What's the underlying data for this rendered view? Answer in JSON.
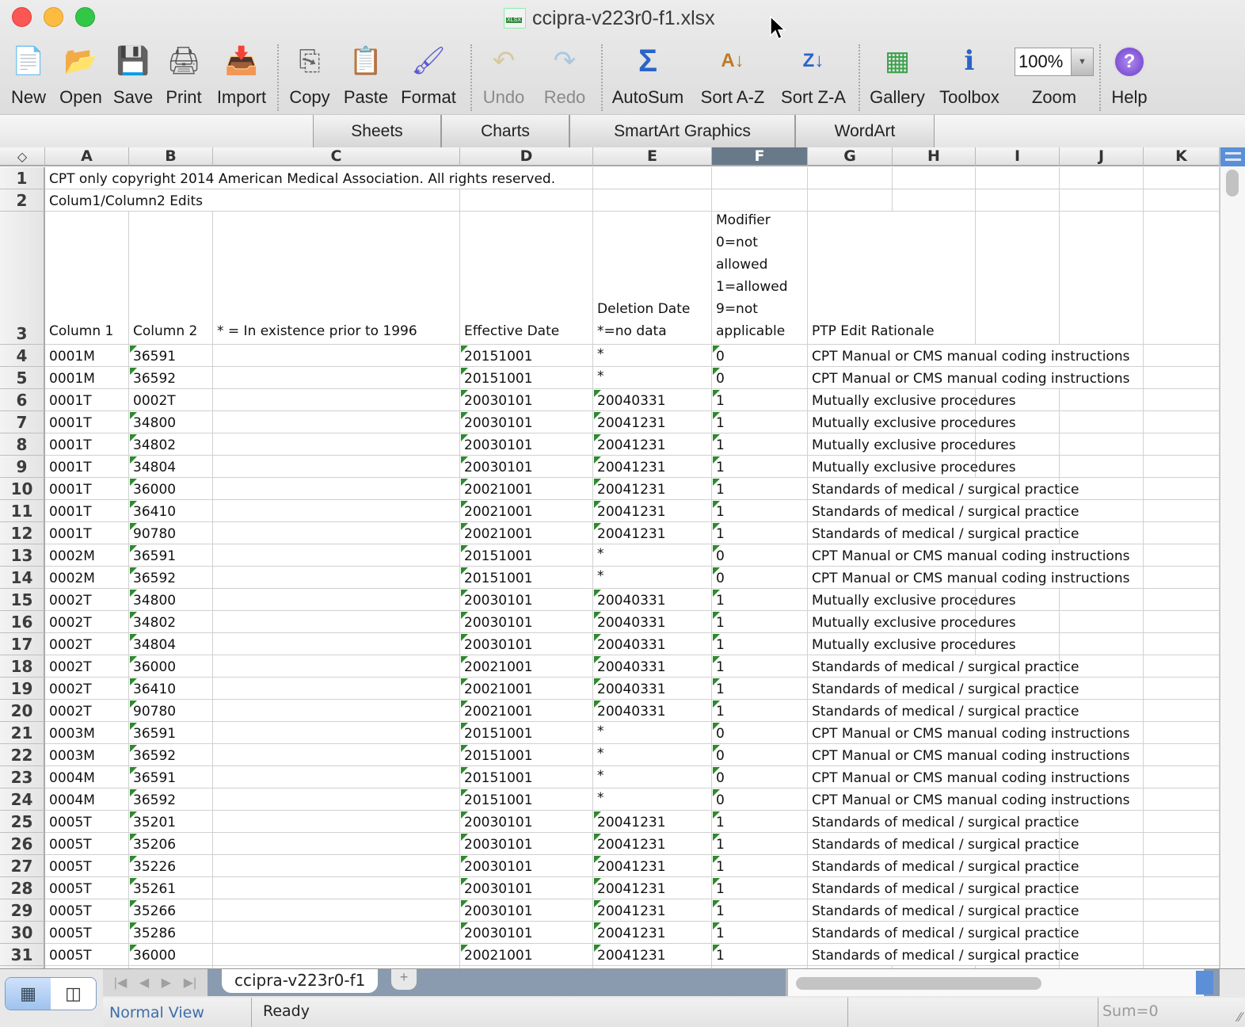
{
  "window": {
    "title": "ccipra-v223r0-f1.xlsx"
  },
  "toolbar": {
    "buttons": [
      {
        "id": "new",
        "label": "New",
        "icon": "new-document-icon",
        "glyph": "📄"
      },
      {
        "id": "open",
        "label": "Open",
        "icon": "open-folder-icon",
        "glyph": "📂"
      },
      {
        "id": "save",
        "label": "Save",
        "icon": "save-disk-icon",
        "glyph": "💾"
      },
      {
        "id": "print",
        "label": "Print",
        "icon": "printer-icon",
        "glyph": "🖨"
      },
      {
        "id": "import",
        "label": "Import",
        "icon": "import-icon",
        "glyph": "📥"
      },
      {
        "id": "copy",
        "label": "Copy",
        "icon": "copy-icon",
        "glyph": "⎘"
      },
      {
        "id": "paste",
        "label": "Paste",
        "icon": "paste-clipboard-icon",
        "glyph": "📋"
      },
      {
        "id": "format",
        "label": "Format",
        "icon": "format-brush-icon",
        "glyph": "🖌"
      },
      {
        "id": "undo",
        "label": "Undo",
        "icon": "undo-icon",
        "glyph": "↶",
        "disabled": true
      },
      {
        "id": "redo",
        "label": "Redo",
        "icon": "redo-icon",
        "glyph": "↷",
        "disabled": true
      },
      {
        "id": "autosum",
        "label": "AutoSum",
        "icon": "sigma-icon",
        "glyph": "Σ"
      },
      {
        "id": "sort-az",
        "label": "Sort A-Z",
        "icon": "sort-ascending-icon",
        "glyph": "A↓"
      },
      {
        "id": "sort-za",
        "label": "Sort Z-A",
        "icon": "sort-descending-icon",
        "glyph": "Z↓"
      },
      {
        "id": "gallery",
        "label": "Gallery",
        "icon": "gallery-icon",
        "glyph": "▦"
      },
      {
        "id": "toolbox",
        "label": "Toolbox",
        "icon": "toolbox-info-icon",
        "glyph": "ℹ"
      },
      {
        "id": "zoom",
        "label": "Zoom",
        "icon": "zoom-select",
        "glyph": ""
      },
      {
        "id": "help",
        "label": "Help",
        "icon": "help-icon",
        "glyph": "?"
      }
    ],
    "zoom_value": "100%"
  },
  "ribbon": {
    "tabs": [
      "Sheets",
      "Charts",
      "SmartArt Graphics",
      "WordArt"
    ]
  },
  "grid": {
    "columns": [
      "A",
      "B",
      "C",
      "D",
      "E",
      "F",
      "G",
      "H",
      "I",
      "J",
      "K"
    ],
    "selected_column": "F",
    "row1": "CPT only copyright 2014 American Medical Association.  All rights reserved.",
    "row2": "Colum1/Column2 Edits",
    "headers": {
      "A": "Column 1",
      "B": "Column 2",
      "C": "* = In existence prior to 1996",
      "D": "Effective Date",
      "E": "Deletion Date\n*=no data",
      "F": "Modifier\n0=not\nallowed\n1=allowed\n9=not\napplicable",
      "G": "PTP Edit Rationale"
    },
    "rows": [
      {
        "n": "4",
        "a": "0001M",
        "b": "36591",
        "d": "20151001",
        "e": "*",
        "f": "0",
        "g": "CPT Manual or CMS manual coding instructions"
      },
      {
        "n": "5",
        "a": "0001M",
        "b": "36592",
        "d": "20151001",
        "e": "*",
        "f": "0",
        "g": "CPT Manual or CMS manual coding instructions"
      },
      {
        "n": "6",
        "a": "0001T",
        "b": "0002T",
        "d": "20030101",
        "e": "20040331",
        "f": "1",
        "g": "Mutually exclusive procedures"
      },
      {
        "n": "7",
        "a": "0001T",
        "b": "34800",
        "d": "20030101",
        "e": "20041231",
        "f": "1",
        "g": "Mutually exclusive procedures"
      },
      {
        "n": "8",
        "a": "0001T",
        "b": "34802",
        "d": "20030101",
        "e": "20041231",
        "f": "1",
        "g": "Mutually exclusive procedures"
      },
      {
        "n": "9",
        "a": "0001T",
        "b": "34804",
        "d": "20030101",
        "e": "20041231",
        "f": "1",
        "g": "Mutually exclusive procedures"
      },
      {
        "n": "10",
        "a": "0001T",
        "b": "36000",
        "d": "20021001",
        "e": "20041231",
        "f": "1",
        "g": "Standards of medical / surgical practice"
      },
      {
        "n": "11",
        "a": "0001T",
        "b": "36410",
        "d": "20021001",
        "e": "20041231",
        "f": "1",
        "g": "Standards of medical / surgical practice"
      },
      {
        "n": "12",
        "a": "0001T",
        "b": "90780",
        "d": "20021001",
        "e": "20041231",
        "f": "1",
        "g": "Standards of medical / surgical practice"
      },
      {
        "n": "13",
        "a": "0002M",
        "b": "36591",
        "d": "20151001",
        "e": "*",
        "f": "0",
        "g": "CPT Manual or CMS manual coding instructions"
      },
      {
        "n": "14",
        "a": "0002M",
        "b": "36592",
        "d": "20151001",
        "e": "*",
        "f": "0",
        "g": "CPT Manual or CMS manual coding instructions"
      },
      {
        "n": "15",
        "a": "0002T",
        "b": "34800",
        "d": "20030101",
        "e": "20040331",
        "f": "1",
        "g": "Mutually exclusive procedures"
      },
      {
        "n": "16",
        "a": "0002T",
        "b": "34802",
        "d": "20030101",
        "e": "20040331",
        "f": "1",
        "g": "Mutually exclusive procedures"
      },
      {
        "n": "17",
        "a": "0002T",
        "b": "34804",
        "d": "20030101",
        "e": "20040331",
        "f": "1",
        "g": "Mutually exclusive procedures"
      },
      {
        "n": "18",
        "a": "0002T",
        "b": "36000",
        "d": "20021001",
        "e": "20040331",
        "f": "1",
        "g": "Standards of medical / surgical practice"
      },
      {
        "n": "19",
        "a": "0002T",
        "b": "36410",
        "d": "20021001",
        "e": "20040331",
        "f": "1",
        "g": "Standards of medical / surgical practice"
      },
      {
        "n": "20",
        "a": "0002T",
        "b": "90780",
        "d": "20021001",
        "e": "20040331",
        "f": "1",
        "g": "Standards of medical / surgical practice"
      },
      {
        "n": "21",
        "a": "0003M",
        "b": "36591",
        "d": "20151001",
        "e": "*",
        "f": "0",
        "g": "CPT Manual or CMS manual coding instructions"
      },
      {
        "n": "22",
        "a": "0003M",
        "b": "36592",
        "d": "20151001",
        "e": "*",
        "f": "0",
        "g": "CPT Manual or CMS manual coding instructions"
      },
      {
        "n": "23",
        "a": "0004M",
        "b": "36591",
        "d": "20151001",
        "e": "*",
        "f": "0",
        "g": "CPT Manual or CMS manual coding instructions"
      },
      {
        "n": "24",
        "a": "0004M",
        "b": "36592",
        "d": "20151001",
        "e": "*",
        "f": "0",
        "g": "CPT Manual or CMS manual coding instructions"
      },
      {
        "n": "25",
        "a": "0005T",
        "b": "35201",
        "d": "20030101",
        "e": "20041231",
        "f": "1",
        "g": "Standards of medical / surgical practice"
      },
      {
        "n": "26",
        "a": "0005T",
        "b": "35206",
        "d": "20030101",
        "e": "20041231",
        "f": "1",
        "g": "Standards of medical / surgical practice"
      },
      {
        "n": "27",
        "a": "0005T",
        "b": "35226",
        "d": "20030101",
        "e": "20041231",
        "f": "1",
        "g": "Standards of medical / surgical practice"
      },
      {
        "n": "28",
        "a": "0005T",
        "b": "35261",
        "d": "20030101",
        "e": "20041231",
        "f": "1",
        "g": "Standards of medical / surgical practice"
      },
      {
        "n": "29",
        "a": "0005T",
        "b": "35266",
        "d": "20030101",
        "e": "20041231",
        "f": "1",
        "g": "Standards of medical / surgical practice"
      },
      {
        "n": "30",
        "a": "0005T",
        "b": "35286",
        "d": "20030101",
        "e": "20041231",
        "f": "1",
        "g": "Standards of medical / surgical practice"
      },
      {
        "n": "31",
        "a": "0005T",
        "b": "36000",
        "d": "20021001",
        "e": "20041231",
        "f": "1",
        "g": "Standards of medical / surgical practice"
      }
    ]
  },
  "sheet_tabs": {
    "active": "ccipra-v223r0-f1",
    "add_label": "+",
    "nav": [
      "|◀",
      "◀",
      "▶",
      "▶|"
    ]
  },
  "status": {
    "view": "Normal View",
    "state": "Ready",
    "sum": "Sum=0"
  }
}
